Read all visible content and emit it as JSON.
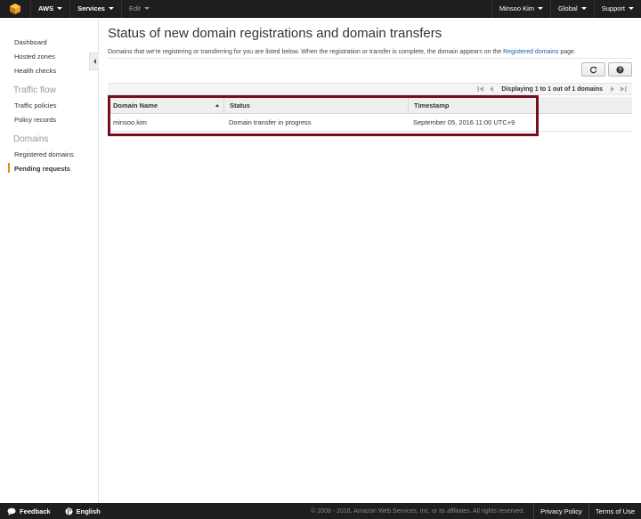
{
  "topnav": {
    "brand": "AWS",
    "services": "Services",
    "edit": "Edit",
    "user": "Minsoo Kim",
    "region": "Global",
    "support": "Support"
  },
  "sidebar": {
    "dashboard": "Dashboard",
    "hosted_zones": "Hosted zones",
    "health_checks": "Health checks",
    "traffic_flow_heading": "Traffic flow",
    "traffic_policies": "Traffic policies",
    "policy_records": "Policy records",
    "domains_heading": "Domains",
    "registered_domains": "Registered domains",
    "pending_requests": "Pending requests"
  },
  "main": {
    "title": "Status of new domain registrations and domain transfers",
    "description_prefix": "Domains that we're registering or transferring for you are listed below. When the registration or transfer is complete, the domain appears on the",
    "description_link": "Registered domains",
    "description_suffix": "page.",
    "pager_text": "Displaying 1 to 1 out of 1 domains",
    "table": {
      "headers": [
        "Domain Name",
        "Status",
        "Timestamp"
      ],
      "rows": [
        [
          "minsoo.kim",
          "Domain transfer in progress",
          "September 05, 2016 11:00 UTC+9"
        ]
      ]
    }
  },
  "footer": {
    "feedback": "Feedback",
    "language": "English",
    "copyright": "© 2008 - 2016, Amazon Web Services, Inc. or its affiliates. All rights reserved.",
    "privacy": "Privacy Policy",
    "terms": "Terms of Use"
  },
  "colors": {
    "topbar": "#1f1f1f",
    "link": "#1a5ea8",
    "active_indicator": "#e88a1a",
    "highlight_border": "#7a0c1f"
  }
}
